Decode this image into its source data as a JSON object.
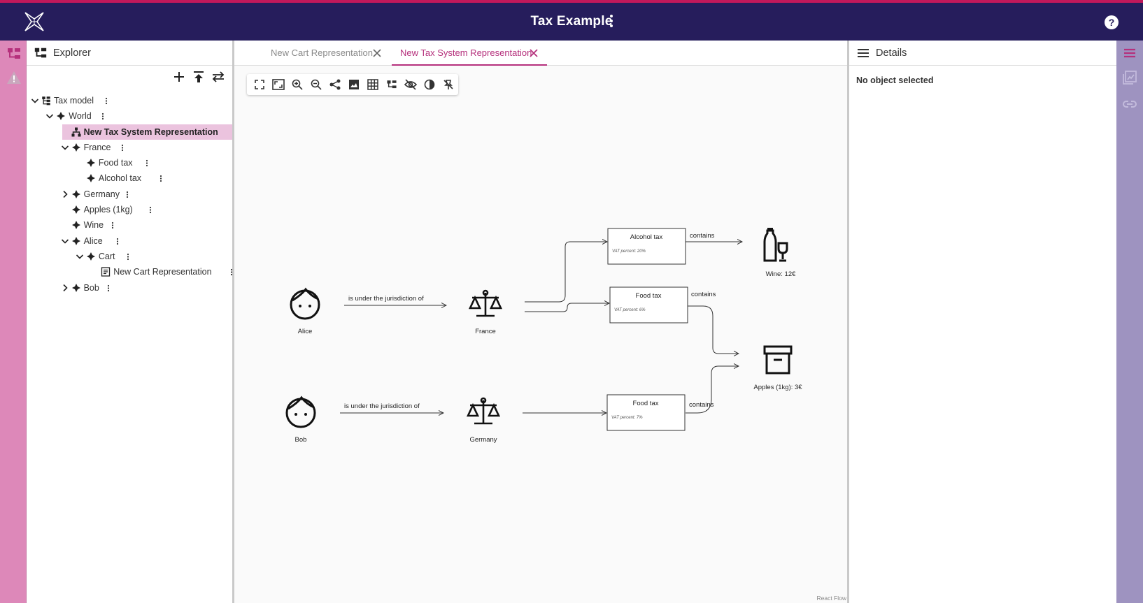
{
  "app": {
    "title": "Tax Example"
  },
  "explorer": {
    "title": "Explorer",
    "tree": [
      {
        "label": "Tax model",
        "depth": 0,
        "expanded": true,
        "icon": "model-icon"
      },
      {
        "label": "World",
        "depth": 1,
        "expanded": true,
        "icon": "object-icon"
      },
      {
        "label": "New Tax System Representation",
        "depth": 2,
        "selected": true,
        "icon": "diagram-icon"
      },
      {
        "label": "France",
        "depth": 2,
        "expanded": true,
        "icon": "object-icon"
      },
      {
        "label": "Food tax",
        "depth": 3,
        "icon": "object-icon"
      },
      {
        "label": "Alcohol tax",
        "depth": 3,
        "icon": "object-icon"
      },
      {
        "label": "Germany",
        "depth": 2,
        "expanded": false,
        "icon": "object-icon"
      },
      {
        "label": "Apples (1kg)",
        "depth": 2,
        "icon": "object-icon"
      },
      {
        "label": "Wine",
        "depth": 2,
        "icon": "object-icon"
      },
      {
        "label": "Alice",
        "depth": 2,
        "expanded": true,
        "icon": "object-icon"
      },
      {
        "label": "Cart",
        "depth": 3,
        "expanded": true,
        "icon": "object-icon"
      },
      {
        "label": "New Cart Representation",
        "depth": 4,
        "icon": "form-icon"
      },
      {
        "label": "Bob",
        "depth": 2,
        "expanded": false,
        "icon": "object-icon"
      }
    ]
  },
  "editor": {
    "tabs": [
      {
        "label": "New Cart Representation",
        "active": false
      },
      {
        "label": "New Tax System Representation",
        "active": true
      }
    ],
    "toolbar_icons": [
      "fit-view-icon",
      "fullscreen-icon",
      "zoom-in-icon",
      "zoom-out-icon",
      "share-icon",
      "export-image-icon",
      "grid-icon",
      "arrange-icon",
      "hide-icon",
      "contrast-icon",
      "unpin-icon"
    ],
    "attribution": "React Flow"
  },
  "diagram": {
    "nodes": {
      "alice": {
        "label": "Alice",
        "icon": "face-icon"
      },
      "bob": {
        "label": "Bob",
        "icon": "face-icon"
      },
      "france": {
        "label": "France",
        "icon": "scales-icon"
      },
      "germany": {
        "label": "Germany",
        "icon": "scales-icon"
      },
      "alcohol_tax_fr": {
        "title": "Alcohol tax",
        "attr": "VAT percent: 20%"
      },
      "food_tax_fr": {
        "title": "Food tax",
        "attr": "VAT percent: 6%"
      },
      "food_tax_de": {
        "title": "Food tax",
        "attr": "VAT percent: 7%"
      },
      "wine": {
        "label": "Wine: 12€",
        "icon": "wine-icon"
      },
      "apples": {
        "label": "Apples (1kg): 3€",
        "icon": "archive-icon"
      }
    },
    "edges": {
      "alice_france": "is under the jurisdiction of",
      "bob_germany": "is under the jurisdiction of",
      "alcohol_wine": "contains",
      "foodfr_apples": "contains",
      "foodde_apples": "contains"
    }
  },
  "details": {
    "title": "Details",
    "empty_text": "No object selected"
  },
  "colors": {
    "header": "#261d5c",
    "accent": "#b5307c",
    "left_rail": "#dd88b9",
    "right_rail": "#9e93c0",
    "selection": "#ebc3de"
  }
}
